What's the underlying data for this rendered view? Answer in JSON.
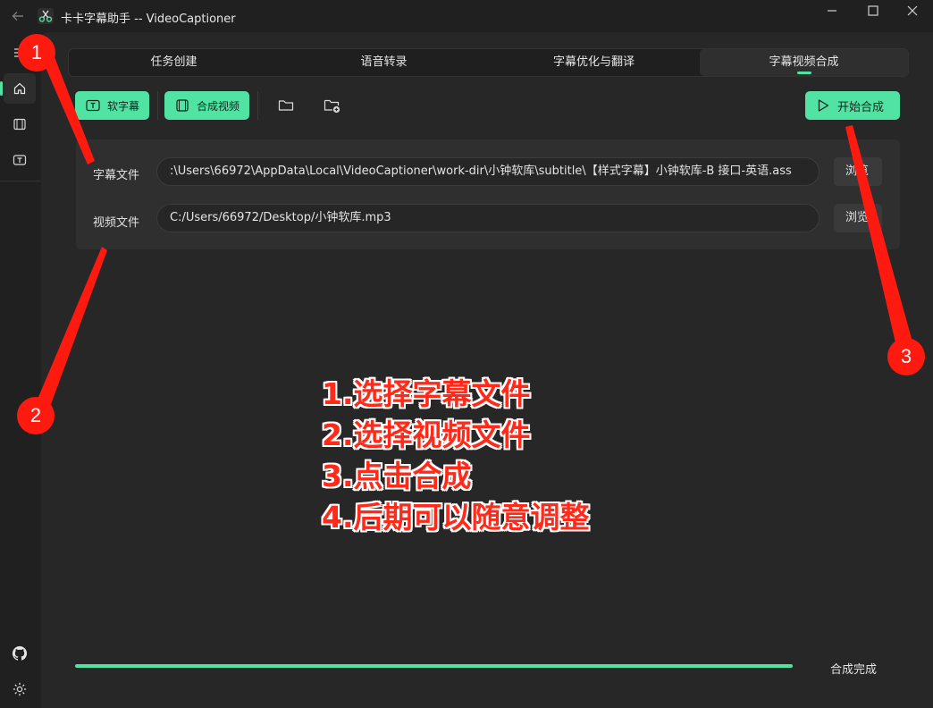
{
  "window": {
    "title": "卡卡字幕助手 -- VideoCaptioner",
    "controls": [
      "minimize",
      "maximize",
      "close"
    ]
  },
  "sidebar": {
    "items": [
      {
        "icon": "menu-icon",
        "active": false
      },
      {
        "icon": "home-icon",
        "active": true
      },
      {
        "icon": "film-icon",
        "active": false
      },
      {
        "icon": "subtitle-icon",
        "active": false
      }
    ],
    "bottom": [
      {
        "icon": "github-icon"
      },
      {
        "icon": "settings-gear-icon"
      }
    ]
  },
  "tabs": [
    {
      "label": "任务创建",
      "active": false
    },
    {
      "label": "语音转录",
      "active": false
    },
    {
      "label": "字幕优化与翻译",
      "active": false
    },
    {
      "label": "字幕视频合成",
      "active": true
    }
  ],
  "toolbar": {
    "soft_subtitle_label": "软字幕",
    "compose_video_label": "合成视频",
    "open_folder_icon": "folder-icon",
    "new_folder_icon": "folder-add-icon",
    "start_label": "开始合成"
  },
  "form": {
    "subtitle_label": "字幕文件",
    "subtitle_path": ":\\Users\\66972\\AppData\\Local\\VideoCaptioner\\work-dir\\小钟软库\\subtitle\\【样式字幕】小钟软库-B 接口-英语.ass",
    "video_label": "视频文件",
    "video_path": "C:/Users/66972/Desktop/小钟软库.mp3",
    "browse_label_1": "浏览",
    "browse_label_2": "浏览"
  },
  "progress": {
    "value": 1.0,
    "status": "合成完成"
  },
  "annotations": {
    "badges": [
      "1",
      "2",
      "3"
    ],
    "lines": [
      "1.选择字幕文件",
      "2.选择视频文件",
      "3.点击合成",
      "4.后期可以随意调整"
    ],
    "color": "#ff1a10"
  },
  "colors": {
    "accent": "#50e3a4",
    "background": "#202020",
    "panel": "#2f2f2f"
  }
}
